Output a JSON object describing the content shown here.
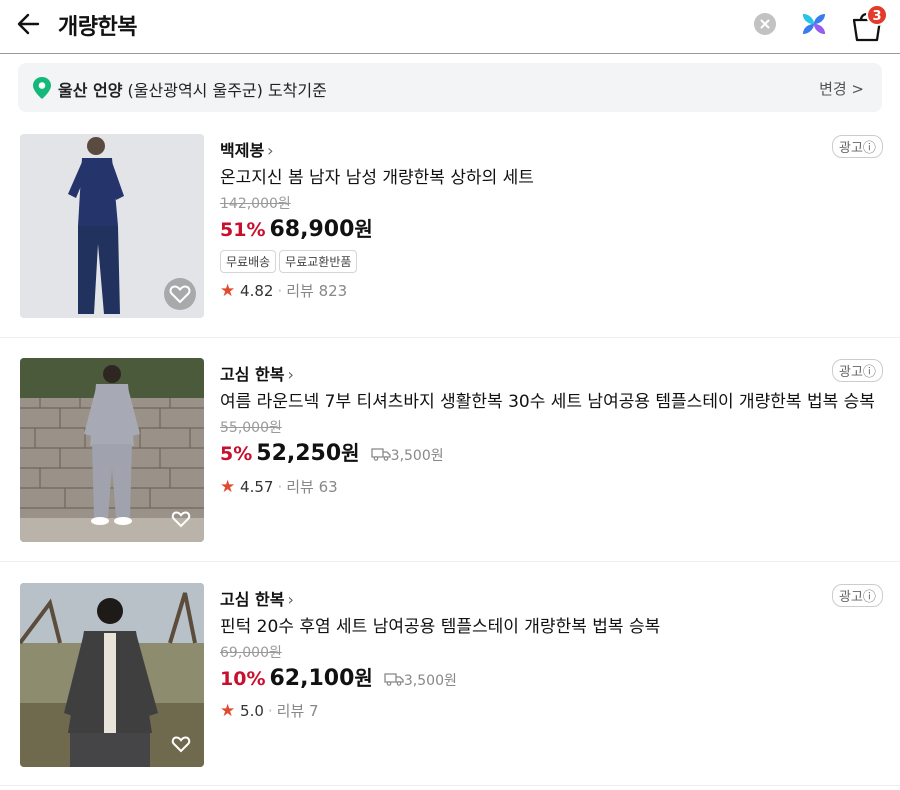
{
  "header": {
    "title": "개량한복",
    "cart_count": "3"
  },
  "location": {
    "region_bold": "울산 언양",
    "region_detail": "(울산광역시 울주군) 도착기준",
    "change_label": "변경 >"
  },
  "ad_label": "광고ⓘ",
  "products": [
    {
      "store": "백제봉",
      "name": "온고지신 봄 남자 남성 개량한복 상하의 세트",
      "original_price": "142,000원",
      "discount": "51%",
      "price": "68,900",
      "won": "원",
      "shipping": "",
      "tags": [
        "무료배송",
        "무료교환반품"
      ],
      "rating": "4.82",
      "reviews": "리뷰 823"
    },
    {
      "store": "고심 한복",
      "name": "여름 라운드넥 7부 티셔츠바지 생활한복 30수 세트 남여공용 템플스테이 개량한복 법복 승복",
      "original_price": "55,000원",
      "discount": "5%",
      "price": "52,250",
      "won": "원",
      "shipping": "3,500원",
      "tags": [],
      "rating": "4.57",
      "reviews": "리뷰 63"
    },
    {
      "store": "고심 한복",
      "name": "핀턱 20수 후염 세트 남여공용 템플스테이 개량한복 법복 승복",
      "original_price": "69,000원",
      "discount": "10%",
      "price": "62,100",
      "won": "원",
      "shipping": "3,500원",
      "tags": [],
      "rating": "5.0",
      "reviews": "리뷰 7"
    }
  ],
  "colors": {
    "discount": "#c8102e",
    "star": "#e24a2f",
    "location_pin": "#14b87a",
    "badge": "#e23b2c"
  },
  "icons": {
    "back": "arrow-left-icon",
    "clear": "clear-circle-icon",
    "ai": "ai-sparkle-icon",
    "cart": "shopping-bag-icon",
    "pin": "location-pin-icon",
    "fav": "heart-icon",
    "ship": "delivery-truck-icon"
  }
}
